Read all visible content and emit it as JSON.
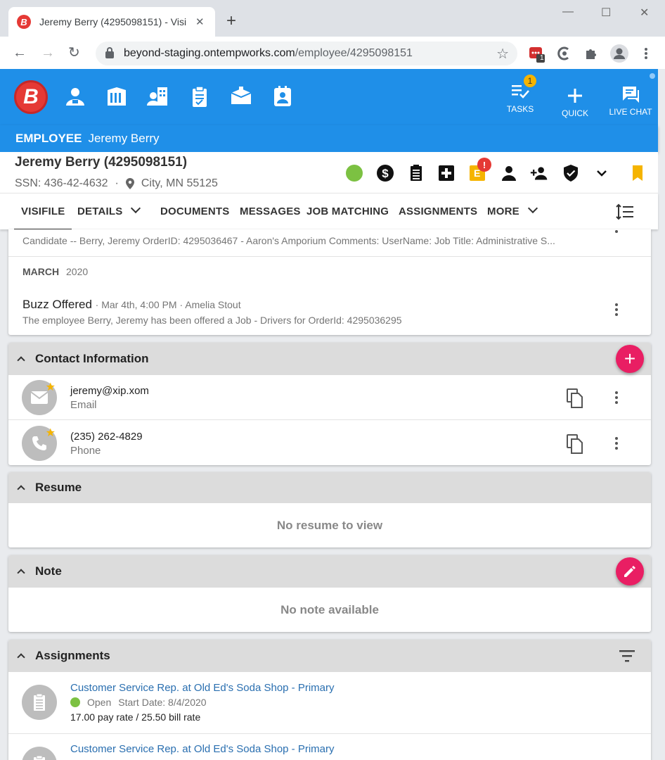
{
  "browser": {
    "tab_title": "Jeremy Berry (4295098151) - Visi",
    "tab_favicon": "B",
    "url_host": "beyond-staging.ontempworks.com",
    "url_path": "/employee/4295098151",
    "ext_badge": "1"
  },
  "app": {
    "logo": "B",
    "tools": {
      "tasks_label": "TASKS",
      "tasks_badge": "1",
      "quick_label": "QUICK",
      "chat_label": "LIVE CHAT"
    },
    "crumb_type": "EMPLOYEE",
    "crumb_name": "Jeremy Berry"
  },
  "employee": {
    "name": "Jeremy Berry (4295098151)",
    "ssn": "SSN: 436-42-4632",
    "separator": "·",
    "location": "City, MN 55125",
    "e_letter": "E",
    "alert_badge": "!"
  },
  "tabs": {
    "visifile": "VISIFILE",
    "details": "DETAILS",
    "documents": "DOCUMENTS",
    "messages": "MESSAGES",
    "job_matching": "JOB MATCHING",
    "assignments": "ASSIGNMENTS",
    "more": "MORE"
  },
  "timeline": {
    "partial_entry_text": "Candidate -- Berry, Jeremy OrderID: 4295036467 - Aaron's Amporium Comments: UserName: Job Title: Administrative S...",
    "month": "MARCH",
    "year": "2020",
    "entry_title": "Buzz Offered",
    "entry_meta": "· Mar 4th, 4:00 PM · Amelia Stout",
    "entry_text": "The employee Berry, Jeremy has been offered a Job - Drivers for OrderId: 4295036295"
  },
  "contact": {
    "title": "Contact Information",
    "items": [
      {
        "value": "jeremy@xip.xom",
        "type": "Email"
      },
      {
        "value": "(235) 262-4829",
        "type": "Phone"
      }
    ]
  },
  "resume": {
    "title": "Resume",
    "empty": "No resume to view"
  },
  "note": {
    "title": "Note",
    "empty": "No note available"
  },
  "assignments": {
    "title": "Assignments",
    "items": [
      {
        "title": "Customer Service Rep. at Old Ed's Soda Shop - Primary",
        "status": "Open",
        "start": "Start Date: 8/4/2020",
        "rates": "17.00 pay rate / 25.50 bill rate"
      },
      {
        "title": "Customer Service Rep. at Old Ed's Soda Shop - Primary"
      }
    ]
  },
  "colors": {
    "brand_blue": "#1f8fe8",
    "brand_red": "#e53935",
    "fab_pink": "#e91e63",
    "status_green": "#7cc142",
    "bookmark_yellow": "#f5b400"
  }
}
